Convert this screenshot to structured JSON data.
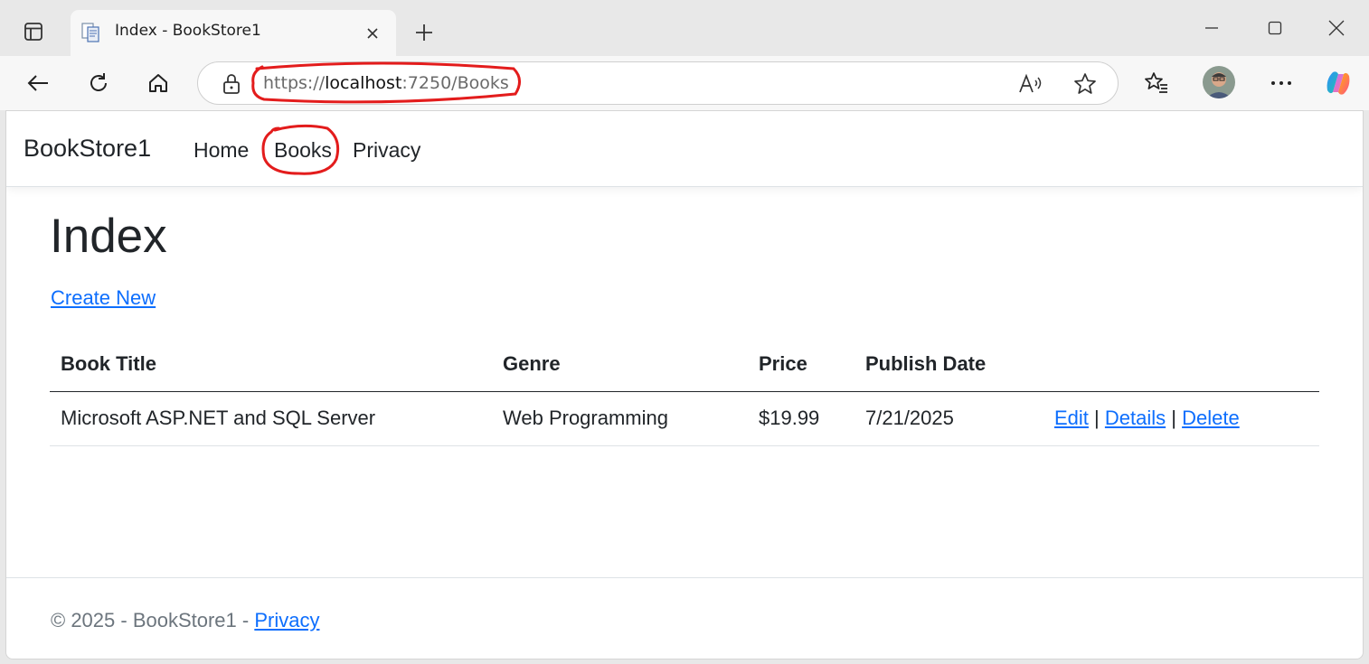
{
  "browser": {
    "tab_title": "Index - BookStore1",
    "url_scheme": "https://",
    "url_host": "localhost",
    "url_rest": ":7250/Books"
  },
  "icons": [
    "sidebar-icon",
    "favicon-icon",
    "close-icon",
    "plus-icon",
    "minimize-icon",
    "maximize-icon",
    "window-close-icon",
    "back-icon",
    "refresh-icon",
    "home-icon",
    "lock-icon",
    "read-aloud-icon",
    "favorite-star-icon",
    "favorites-icon",
    "avatar",
    "more-icon",
    "copilot-icon"
  ],
  "annotation_color": "#e31c1c",
  "nav": {
    "brand": "BookStore1",
    "items": [
      {
        "label": "Home"
      },
      {
        "label": "Books"
      },
      {
        "label": "Privacy"
      }
    ]
  },
  "main": {
    "title": "Index",
    "create_label": "Create New",
    "table": {
      "headers": [
        "Book Title",
        "Genre",
        "Price",
        "Publish Date"
      ],
      "rows": [
        {
          "title": "Microsoft ASP.NET and SQL Server",
          "genre": "Web Programming",
          "price": "$19.99",
          "date": "7/21/2025",
          "actions": {
            "edit": "Edit",
            "details": "Details",
            "delete": "Delete",
            "separator": "|"
          }
        }
      ]
    }
  },
  "footer": {
    "text": "© 2025 - BookStore1 - ",
    "link": "Privacy"
  },
  "colors": {
    "link": "#0d6efd",
    "text": "#212529",
    "muted": "#6c757d"
  }
}
